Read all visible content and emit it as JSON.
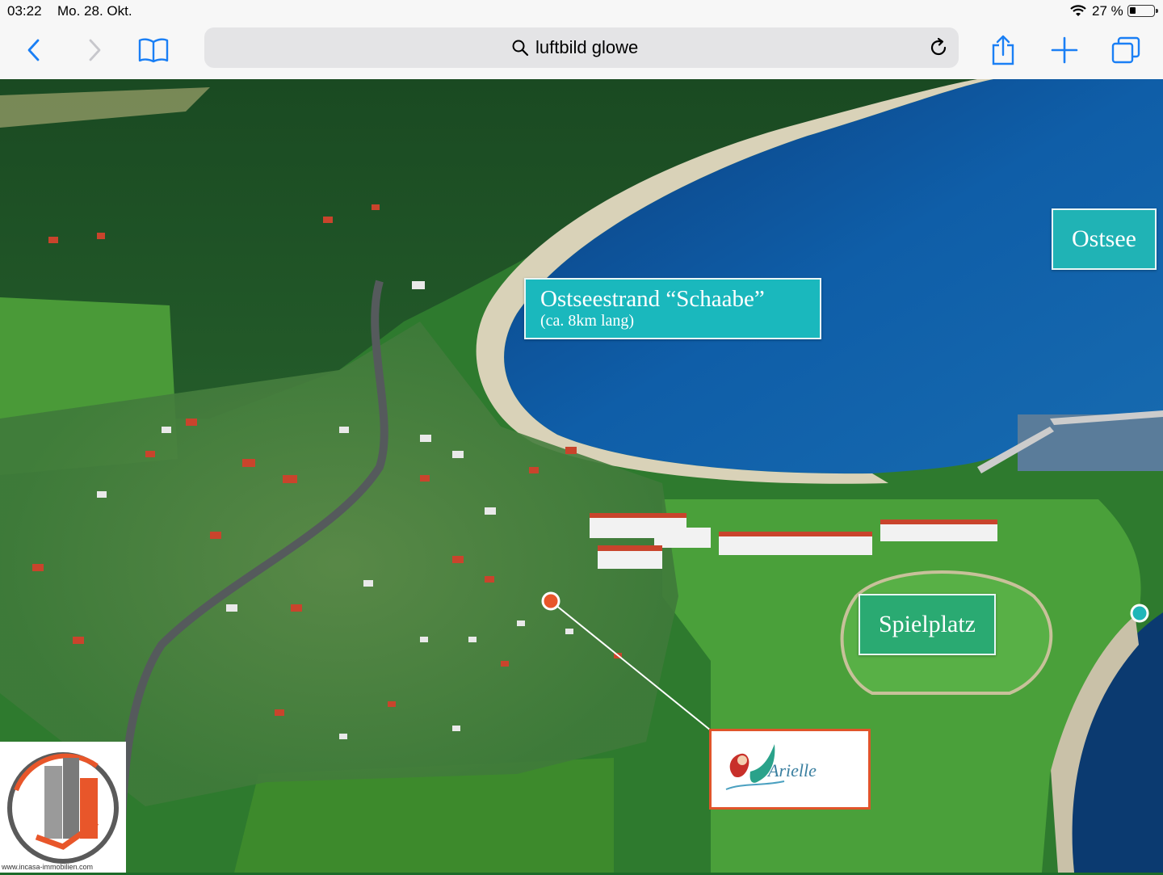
{
  "status": {
    "time": "03:22",
    "date": "Mo. 28. Okt.",
    "battery_pct": "27 %",
    "battery_level": 0.27
  },
  "toolbar": {
    "url": "luftbild glowe"
  },
  "icons": [
    "back-icon",
    "forward-icon",
    "bookmarks-icon",
    "search-icon",
    "reload-icon",
    "share-icon",
    "new-tab-icon",
    "tabs-icon"
  ],
  "colors": {
    "accent": "#1a7ff5",
    "label_teal": "#1fb6b8",
    "label_green": "#2aaa72",
    "sea": "#0d5aa8",
    "marker": "#e8562a"
  },
  "labels": {
    "ostsee": "Ostsee",
    "strand_main": "Ostseestrand “Schaabe”",
    "strand_sub": "(ca. 8km lang)",
    "spielplatz": "Spielplatz",
    "arielle": "Arielle",
    "logo_url": "www.incasa-immobilien.com"
  }
}
